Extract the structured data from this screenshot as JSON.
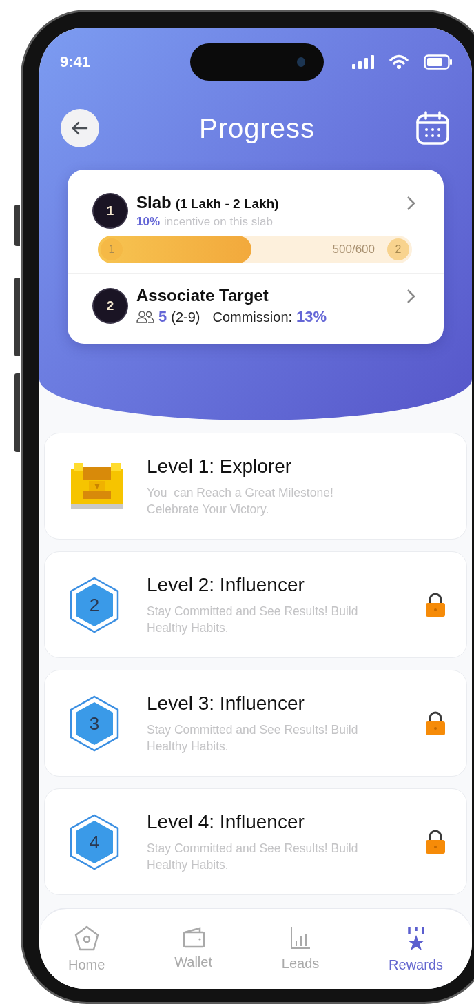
{
  "status_bar": {
    "time": "9:41"
  },
  "header": {
    "title": "Progress"
  },
  "summary": [
    {
      "kind": "slab",
      "badge": "1",
      "title": "Slab",
      "range": "(1 Lakh - 2 Lakh)",
      "highlight": "10%",
      "subtitle": "incentive on this slab",
      "progress": {
        "start": "1",
        "reading": "500/600",
        "end": "2",
        "level": 0.49
      }
    },
    {
      "kind": "target",
      "badge": "2",
      "title": "Associate Target",
      "count": "5",
      "count_range": "(2-9)",
      "commission_label": "Commission:",
      "commission": "13%"
    }
  ],
  "levels": [
    {
      "kind": "chest",
      "title": "Level 1: Explorer",
      "description": "You  can Reach a Great Milestone! Celebrate Your Victory.",
      "locked": false
    },
    {
      "kind": "hexagon",
      "number": "2",
      "title": "Level 2: Influencer",
      "description": "Stay Committed and See Results! Build Healthy Habits.",
      "locked": true
    },
    {
      "kind": "hexagon",
      "number": "3",
      "title": "Level 3: Influencer",
      "description": "Stay Committed and See Results! Build Healthy Habits.",
      "locked": true
    },
    {
      "kind": "hexagon",
      "number": "4",
      "title": "Level 4: Influencer",
      "description": "Stay Committed and See Results! Build Healthy Habits.",
      "locked": true
    }
  ],
  "tab_bar": [
    {
      "kind": "home",
      "label": "Home",
      "selected": false
    },
    {
      "kind": "wallet",
      "label": "Wallet",
      "selected": false
    },
    {
      "kind": "leads",
      "label": "Leads",
      "selected": false
    },
    {
      "kind": "rewards",
      "label": "Rewards",
      "selected": true
    }
  ]
}
